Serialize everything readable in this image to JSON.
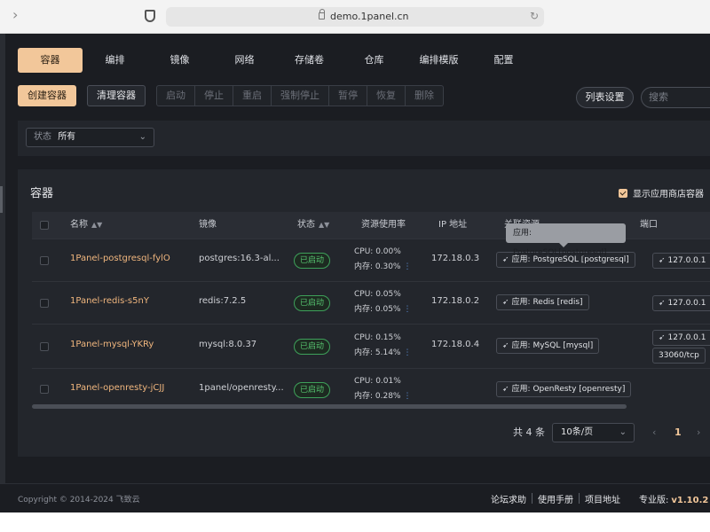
{
  "browser": {
    "url": "demo.1panel.cn"
  },
  "nav": {
    "tabs": [
      "容器",
      "编排",
      "镜像",
      "网络",
      "存储卷",
      "仓库",
      "编排模版",
      "配置"
    ],
    "active_index": 0
  },
  "toolbar": {
    "create": "创建容器",
    "clean": "清理容器",
    "group": [
      "启动",
      "停止",
      "重启",
      "强制停止",
      "暂停",
      "恢复",
      "删除"
    ],
    "list_settings": "列表设置",
    "search_placeholder": "搜索"
  },
  "filter": {
    "label": "状态",
    "value": "所有"
  },
  "panel": {
    "title": "容器",
    "show_store": "显示应用商店容器"
  },
  "table": {
    "headers": {
      "name": "名称",
      "image": "镜像",
      "status": "状态",
      "usage": "资源使用率",
      "ip": "IP 地址",
      "related": "关联资源",
      "port": "端口"
    },
    "rows": [
      {
        "name": "1Panel-postgresql-fylO",
        "image": "postgres:16.3-al...",
        "status": "已启动",
        "cpu": "CPU: 0.00%",
        "mem": "内存: 0.30%",
        "ip": "172.18.0.3",
        "app": "应用: PostgreSQL [postgresql]",
        "ports": [
          "127.0.0.1"
        ]
      },
      {
        "name": "1Panel-redis-s5nY",
        "image": "redis:7.2.5",
        "status": "已启动",
        "cpu": "CPU: 0.05%",
        "mem": "内存: 0.05%",
        "ip": "172.18.0.2",
        "app": "应用: Redis [redis]",
        "ports": [
          "127.0.0.1"
        ]
      },
      {
        "name": "1Panel-mysql-YKRy",
        "image": "mysql:8.0.37",
        "status": "已启动",
        "cpu": "CPU: 0.15%",
        "mem": "内存: 5.14%",
        "ip": "172.18.0.4",
        "app": "应用: MySQL [mysql]",
        "ports": [
          "127.0.0.1",
          "33060/tcp"
        ]
      },
      {
        "name": "1Panel-openresty-jCJJ",
        "image": "1panel/openresty...",
        "status": "已启动",
        "cpu": "CPU: 0.01%",
        "mem": "内存: 0.28%",
        "ip": "",
        "app": "应用: OpenResty [openresty]",
        "ports": []
      }
    ],
    "tooltip": "应用: PostgreSQL[postgresql]"
  },
  "pager": {
    "total": "共 4 条",
    "page_size": "10条/页",
    "current": "1"
  },
  "footer": {
    "copyright": "Copyright © 2014-2024 飞致云",
    "links": [
      "论坛求助",
      "使用手册",
      "项目地址"
    ],
    "edition": "专业版:",
    "version": "v1.10.2"
  },
  "colors": {
    "accent": "#f2c79a",
    "running": "#56c26f",
    "name_link": "#f0b67e",
    "bg": "#1b1d22"
  }
}
